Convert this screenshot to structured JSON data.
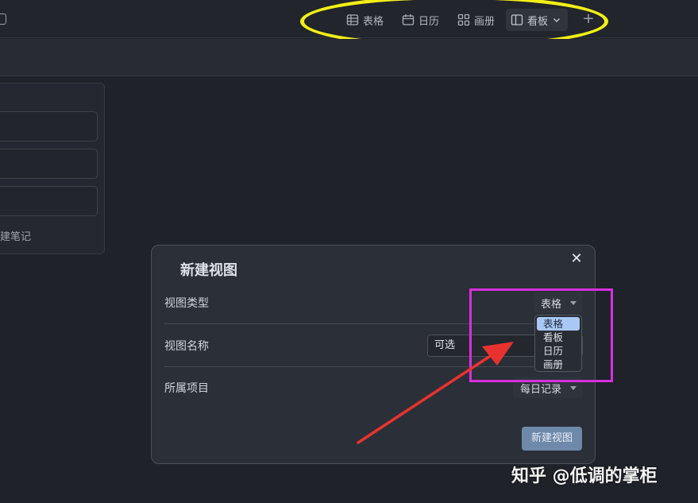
{
  "toolbar": {
    "views": [
      {
        "label": "表格",
        "icon": "table-icon"
      },
      {
        "label": "日历",
        "icon": "calendar-icon"
      },
      {
        "label": "画册",
        "icon": "gallery-icon"
      },
      {
        "label": "看板",
        "icon": "board-icon",
        "active": true
      }
    ],
    "add_icon": "plus-icon"
  },
  "left_panel": {
    "note_label": "建笔记"
  },
  "modal": {
    "title": "新建视图",
    "close_icon": "close-icon",
    "view_type_label": "视图类型",
    "view_type_value": "表格",
    "view_type_options": [
      "表格",
      "看板",
      "日历",
      "画册"
    ],
    "view_name_label": "视图名称",
    "view_name_value": "可选",
    "project_label": "所属项目",
    "project_value": "每日记录",
    "create_button": "新建视图"
  },
  "watermark": "知乎 @低调的掌柜",
  "colors": {
    "annotation_ellipse": "#f3ef16",
    "annotation_box": "#d82ee0",
    "annotation_arrow": "#e8322f",
    "selected_option": "#a9c8f5",
    "primary_button": "#6e89aa"
  }
}
